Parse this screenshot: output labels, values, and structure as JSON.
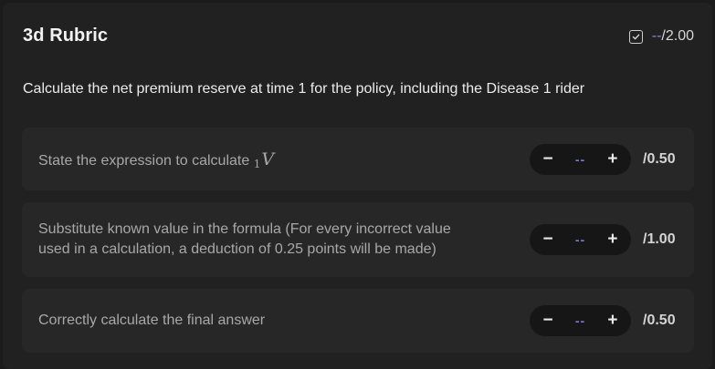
{
  "header": {
    "title": "3d Rubric",
    "score_current": "--",
    "score_total": "/2.00",
    "check_icon": "checkbox-check-icon"
  },
  "question": "Calculate the net premium reserve at time 1 for the policy, including the Disease 1 rider",
  "rubric_items": [
    {
      "description_prefix": "State the expression to calculate ",
      "math_subscript": "1",
      "math_symbol": "V",
      "decrement": "−",
      "increment": "+",
      "value": "--",
      "max": "/0.50"
    },
    {
      "description_line1": "Substitute known value in the formula (For every incorrect value",
      "description_line2": "used in a calculation, a deduction of 0.25 points will be made)",
      "decrement": "−",
      "increment": "+",
      "value": "--",
      "max": "/1.00"
    },
    {
      "description": "Correctly calculate the final answer",
      "decrement": "−",
      "increment": "+",
      "value": "--",
      "max": "/0.50"
    }
  ],
  "colors": {
    "background": "#1b1b1b",
    "panel": "#212121",
    "row": "#272727",
    "stepper": "#161616",
    "accent": "#8b86d8"
  }
}
